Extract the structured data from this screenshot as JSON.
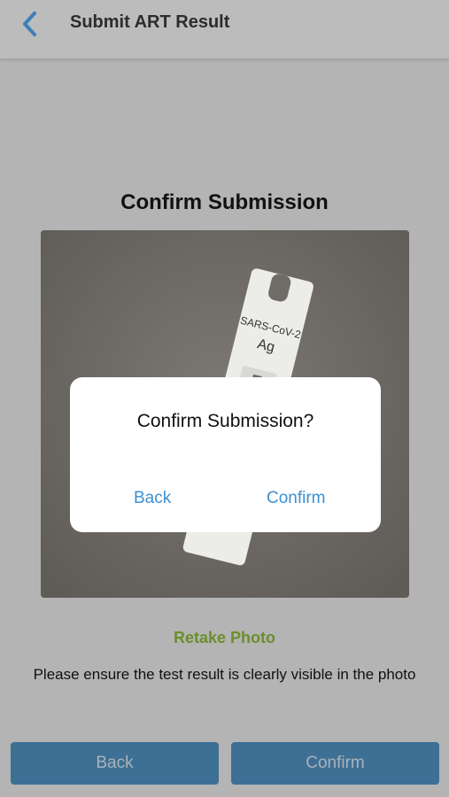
{
  "header": {
    "title": "Submit ART Result",
    "back_icon": "chevron-left-icon"
  },
  "main": {
    "title": "Confirm Submission",
    "photo": {
      "test_label_line1": "SARS-CoV-2",
      "test_label_line2": "Ag"
    },
    "retake_label": "Retake Photo",
    "hint": "Please ensure the test result is clearly visible in the photo"
  },
  "footer": {
    "back_label": "Back",
    "confirm_label": "Confirm"
  },
  "dialog": {
    "title": "Confirm Submission?",
    "back_label": "Back",
    "confirm_label": "Confirm"
  },
  "colors": {
    "accent": "#3d8fd0",
    "retake": "#6a8f2c",
    "button_bg": "#3e6f94"
  }
}
